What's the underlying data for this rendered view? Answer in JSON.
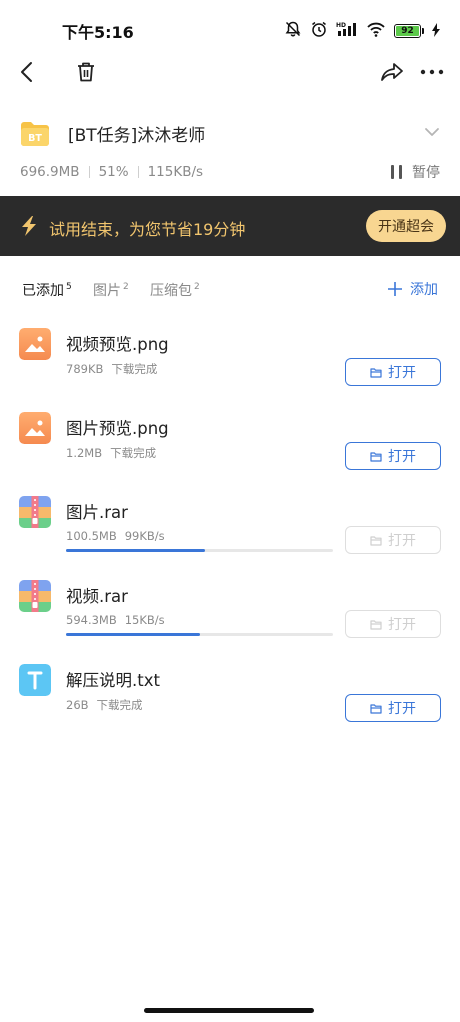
{
  "status_bar": {
    "time": "下午5:16",
    "battery": "92",
    "icons": [
      "mute-icon",
      "alarm-icon",
      "signal-icon",
      "wifi-icon",
      "battery-icon",
      "charging-icon"
    ]
  },
  "top_bar": {
    "icons": [
      "back-icon",
      "trash-icon",
      "share-icon",
      "more-icon"
    ]
  },
  "task": {
    "badge": "BT",
    "title": "[BT任务]沐沐老师",
    "size": "696.9MB",
    "percent": "51%",
    "speed": "115KB/s",
    "pause_label": "暂停"
  },
  "trial_banner": {
    "text": "试用结束，为您节省19分钟",
    "button": "开通超会",
    "colors": {
      "background": "#2b2b2b",
      "text": "#f1c56e",
      "button": "#f8d691"
    }
  },
  "tabs": [
    {
      "label": "已添加",
      "count": "5",
      "active": true
    },
    {
      "label": "图片",
      "count": "2",
      "active": false
    },
    {
      "label": "压缩包",
      "count": "2",
      "active": false
    }
  ],
  "add_label": "添加",
  "files": [
    {
      "name": "视频预览.png",
      "size": "789KB",
      "status": "下载完成",
      "icon": "image-file-icon",
      "open_label": "打开"
    },
    {
      "name": "图片预览.png",
      "size": "1.2MB",
      "status": "下载完成",
      "icon": "image-file-icon",
      "open_label": "打开"
    },
    {
      "name": "图片.rar",
      "size": "100.5MB",
      "status": "99KB/s",
      "icon": "archive-file-icon",
      "open_label": "打开",
      "progress": 0.52
    },
    {
      "name": "视频.rar",
      "size": "594.3MB",
      "status": "15KB/s",
      "icon": "archive-file-icon",
      "open_label": "打开",
      "progress": 0.5
    },
    {
      "name": "解压说明.txt",
      "size": "26B",
      "status": "下载完成",
      "icon": "text-file-icon",
      "open_label": "打开"
    }
  ],
  "colors": {
    "accent": "#3a76d8",
    "muted": "#8a8a8a"
  }
}
